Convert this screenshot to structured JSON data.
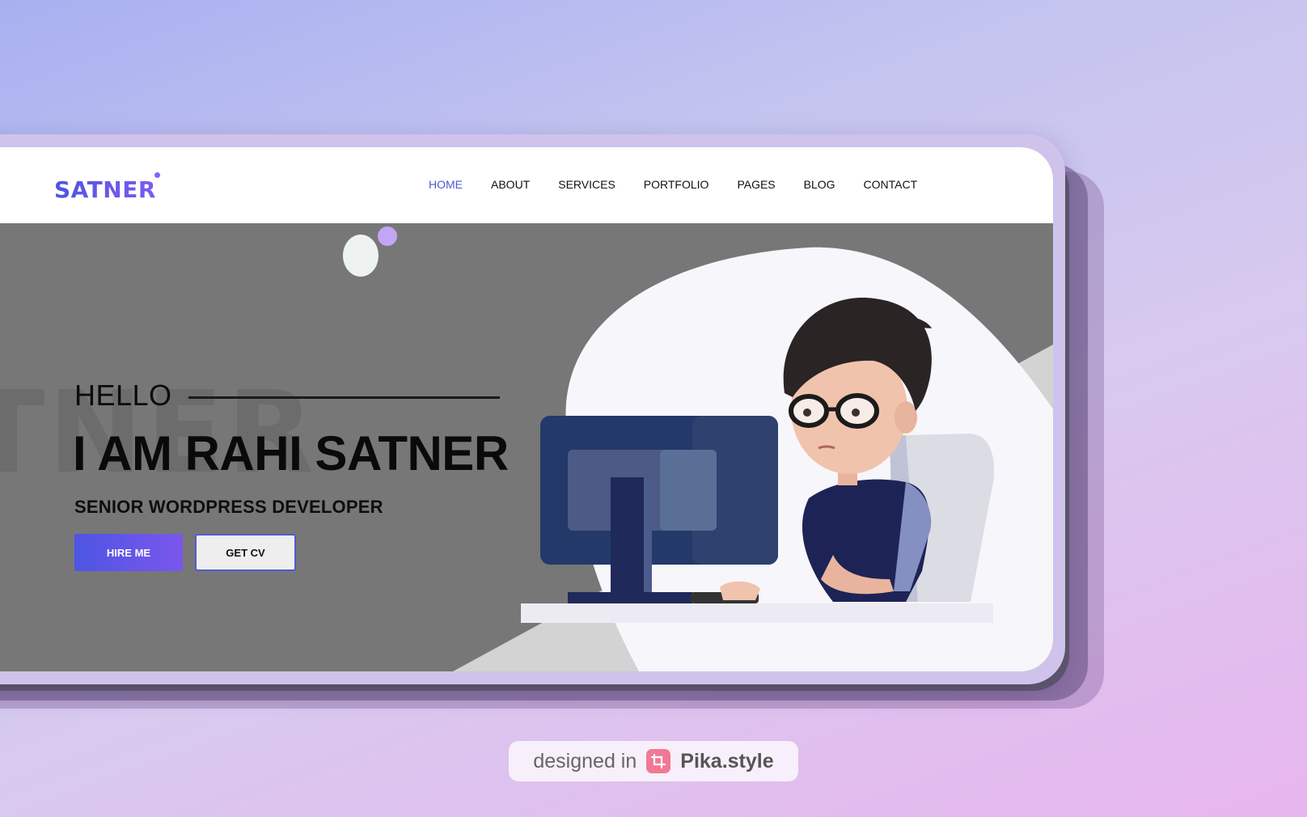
{
  "header": {
    "logo": "SATNER",
    "nav": [
      {
        "label": "HOME",
        "active": true
      },
      {
        "label": "ABOUT"
      },
      {
        "label": "SERVICES"
      },
      {
        "label": "PORTFOLIO"
      },
      {
        "label": "PAGES"
      },
      {
        "label": "BLOG"
      },
      {
        "label": "CONTACT"
      }
    ]
  },
  "hero": {
    "background_word": "TNER",
    "greeting": "HELLO",
    "name": "I AM RAHI SATNER",
    "role": "SENIOR WORDPRESS DEVELOPER",
    "buttons": {
      "hire": "HIRE ME",
      "cv": "GET CV"
    },
    "illustration": "developer-at-computer-illustration"
  },
  "watermark": {
    "prefix": "designed in",
    "brand": "Pika.style",
    "icon": "crop-icon"
  },
  "colors": {
    "accent": "#4f55e0",
    "accent_end": "#7b56ec",
    "hero_bg": "#777777",
    "nav_active": "#4a5ad8"
  }
}
